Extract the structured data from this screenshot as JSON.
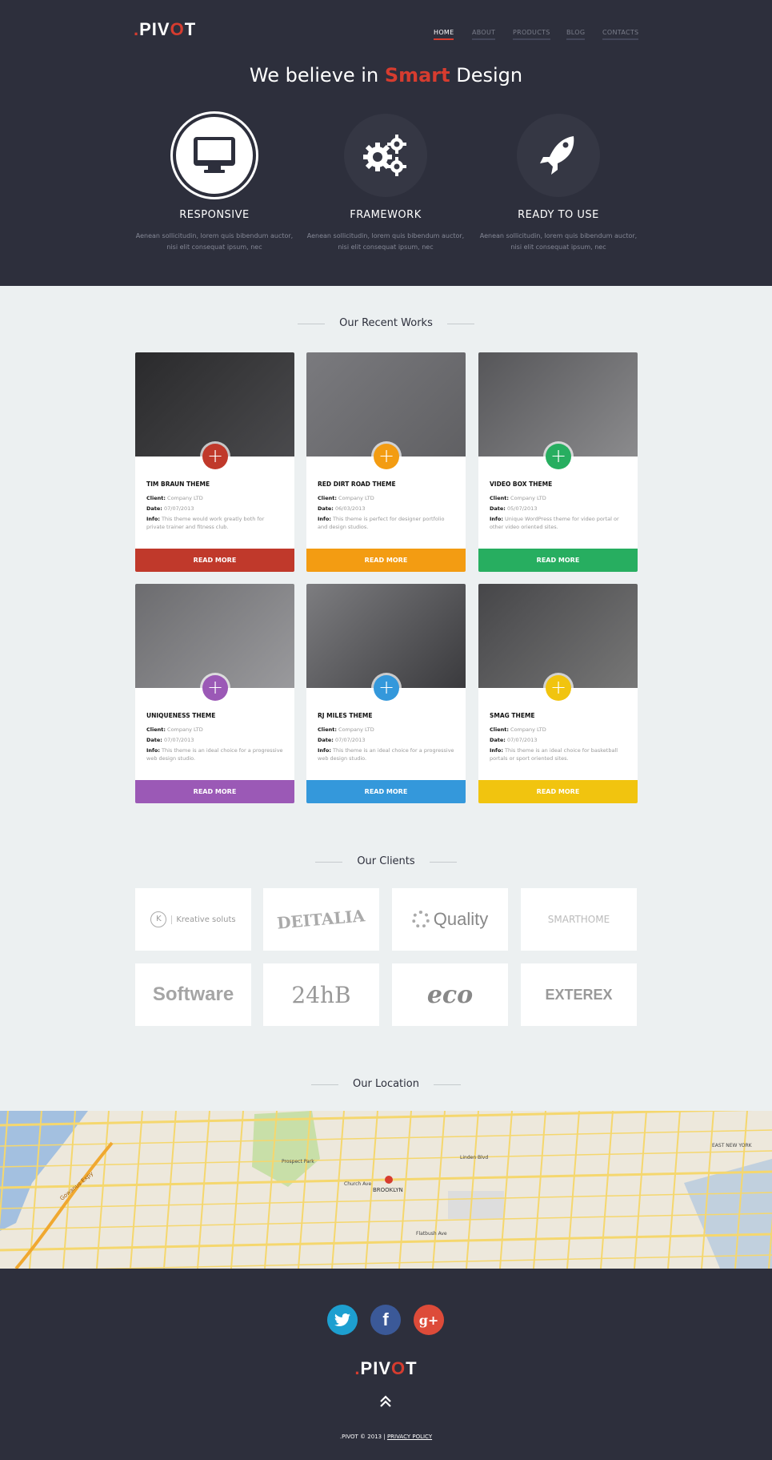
{
  "brand": {
    "logo_prefix": ".",
    "logo_main": "PIV",
    "logo_o": "O",
    "logo_end": "T",
    "accent": "#d63c2f"
  },
  "nav": [
    {
      "label": "HOME",
      "active": true
    },
    {
      "label": "ABOUT"
    },
    {
      "label": "PRODUCTS"
    },
    {
      "label": "BLOG"
    },
    {
      "label": "CONTACTS"
    }
  ],
  "hero": {
    "headline_pre": "We believe in ",
    "headline_hl": "Smart",
    "headline_post": " Design",
    "features": [
      {
        "icon": "monitor-icon",
        "title": "RESPONSIVE",
        "text": "Aenean sollicitudin, lorem quis bibendum auctor, nisi elit consequat ipsum, nec"
      },
      {
        "icon": "gears-icon",
        "title": "FRAMEWORK",
        "text": "Aenean sollicitudin, lorem quis bibendum auctor, nisi elit consequat ipsum, nec"
      },
      {
        "icon": "rocket-icon",
        "title": "READY TO USE",
        "text": "Aenean sollicitudin, lorem quis bibendum auctor, nisi elit consequat ipsum, nec"
      }
    ]
  },
  "works": {
    "title": "Our Recent Works",
    "client_label": "Client:",
    "date_label": "Date:",
    "info_label": "Info:",
    "button": "READ MORE",
    "items": [
      {
        "title": "TIM BRAUN THEME",
        "client": "Company LTD",
        "date": "07/07/2013",
        "info": "This theme would work greatly both for private trainer and fitness club.",
        "color": "#c0392b"
      },
      {
        "title": "RED DIRT ROAD THEME",
        "client": "Company LTD",
        "date": "06/03/2013",
        "info": "This theme is perfect for designer portfolio and design studios.",
        "color": "#f39c12"
      },
      {
        "title": "VIDEO BOX THEME",
        "client": "Company LTD",
        "date": "05/07/2013",
        "info": "Unique WordPress theme for video portal or other video oriented sites.",
        "color": "#27ae60"
      },
      {
        "title": "UNIQUENESS THEME",
        "client": "Company LTD",
        "date": "07/07/2013",
        "info": "This theme is an ideal choice for a progressive web design studio.",
        "color": "#9b59b6"
      },
      {
        "title": "RJ MILES THEME",
        "client": "Company LTD",
        "date": "07/07/2013",
        "info": "This theme is an ideal choice for a progressive web design studio.",
        "color": "#3498db"
      },
      {
        "title": "SMAG THEME",
        "client": "Company LTD",
        "date": "07/07/2013",
        "info": "This theme is an ideal choice for basketball portals or sport oriented sites.",
        "color": "#f1c40f"
      }
    ]
  },
  "clients": {
    "title": "Our Clients",
    "logos": [
      "Kreative soluts",
      "DEITALIA",
      "Quality",
      "SMARTHOME",
      "Software",
      "24hB",
      "eco",
      "EXTEREX"
    ]
  },
  "location": {
    "title": "Our Location",
    "labels": [
      "Prospect Park",
      "BROOKLYN",
      "Linden Blvd",
      "Church Ave",
      "Flatbush Ave",
      "EAST NEW YORK",
      "Gowanus Expy"
    ]
  },
  "footer": {
    "social": [
      "twitter",
      "facebook",
      "google-plus"
    ],
    "copyright": ".PIVOT © 2013",
    "separator": "|",
    "privacy": "PRIVACY POLICY"
  }
}
